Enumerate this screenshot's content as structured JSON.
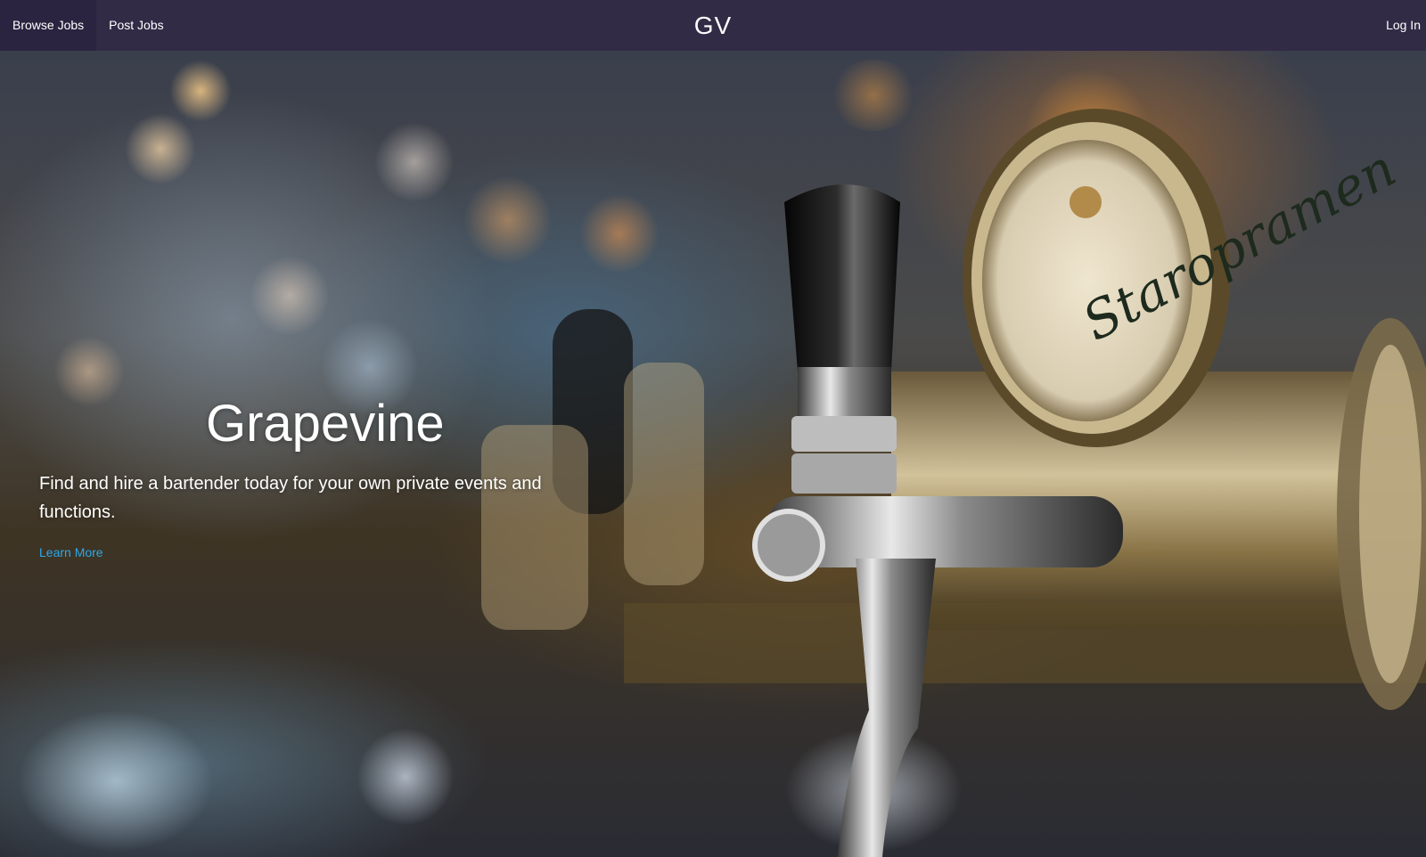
{
  "navbar": {
    "left_items": [
      {
        "label": "Browse Jobs",
        "active": true
      },
      {
        "label": "Post Jobs",
        "active": false
      }
    ],
    "brand": "GV",
    "login_label": "Log In",
    "background_color": "#322b46"
  },
  "hero": {
    "title": "Grapevine",
    "subtitle": "Find and hire a bartender today for your own private events and functions.",
    "link_label": "Learn More",
    "link_color": "#2ea8e6",
    "background_image": "beer-taps-bar-photo",
    "tap_badge_text": "Staropramen"
  }
}
